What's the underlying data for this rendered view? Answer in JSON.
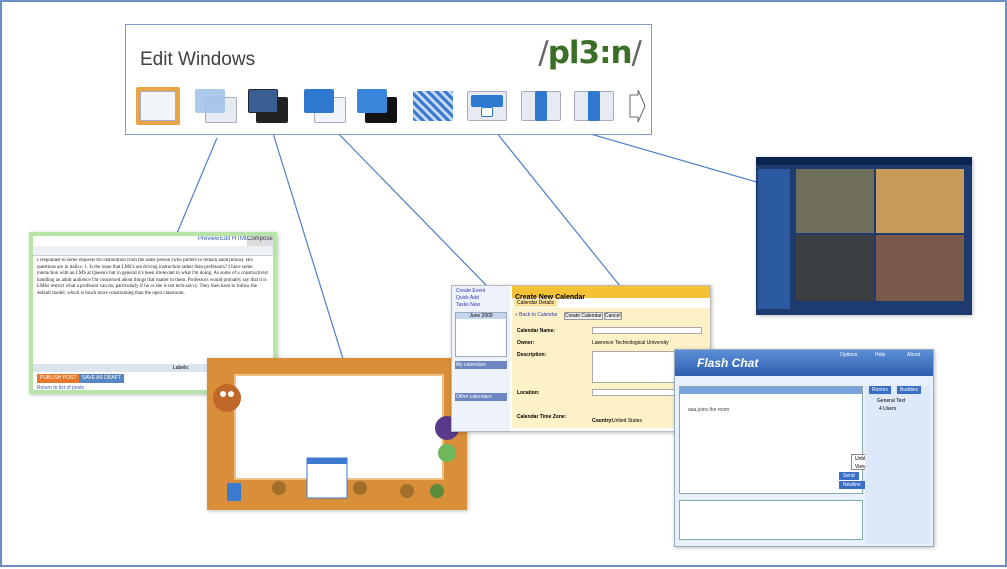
{
  "toolbar": {
    "title": "Edit Windows",
    "brand": "pl3:n",
    "icons": [
      "window-plain-icon",
      "window-translucent-stack-icon",
      "window-dark-stack-icon",
      "window-blue-stack-icon",
      "window-black-shadow-icon",
      "window-checker-icon",
      "window-download-icon",
      "window-left-arrow-icon",
      "window-right-arrow-icon",
      "window-outline-arrow-icon"
    ]
  },
  "editor": {
    "tabs": [
      "Preview",
      "Edit HTML",
      "Compose"
    ],
    "body_text": "I responded to some requests for elaboration from the same person (who prefers to remain anonymous). His questions are in italics: 1. Is the issue that LMS's are driving instruction rather than professors? I have some interaction with an LMS at Queen's but in general it's been irrelevant to what I'm doing. As some of a constructivist handling an adult audience I'm concerned about things that matter to them. Professors would probably say that it is LMSs restrict what a professor can do, particularly if he or she is not tech-savvy. They then have to follow the default model, which is much more constraining than the open classroom.",
    "buttons": [
      "PUBLISH POST",
      "SAVE AS DRAFT"
    ],
    "footer_link": "Return to list of posts",
    "labels_text": "Labels:"
  },
  "calendar": {
    "sidebar_links": [
      "Create Event",
      "Quick Add",
      "Tasks New"
    ],
    "month": "June 2009",
    "title": "Create New Calendar",
    "tab": "Calendar Details",
    "buttons": [
      "« Back to Calendar",
      "Create Calendar",
      "Cancel"
    ],
    "fields": [
      "Calendar Name:",
      "Owner:",
      "Description:",
      "Location:",
      "Calendar Time Zone:"
    ],
    "owner_value": "Lawrence Technological University",
    "country_label": "Country:",
    "country_value": "United States",
    "sections": [
      "My calendars",
      "Other calendars"
    ]
  },
  "chat": {
    "title": "Flash Chat",
    "menu": [
      "Options",
      "Help",
      "About"
    ],
    "tabs": [
      "Rooms",
      "Buddies"
    ],
    "room": "General Text",
    "users_count": "4 Users",
    "context_menu": [
      "Unblock",
      "View profile"
    ],
    "buttons": [
      "Send",
      "Newline"
    ],
    "user_joined": "aaa.joins the room"
  },
  "colors": {
    "frame_border": "#6b8fc5",
    "connector": "#4f7ec9",
    "brand_green": "#3b6f25",
    "editor_border": "#b7e5a8",
    "game_orange": "#d98f3a"
  }
}
